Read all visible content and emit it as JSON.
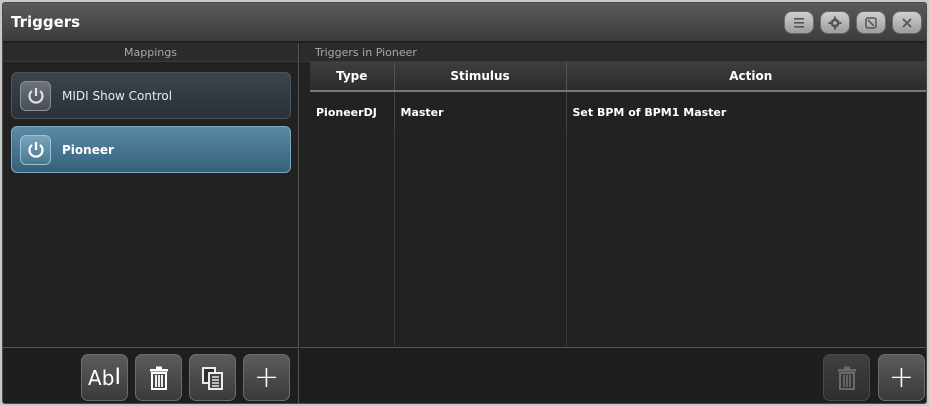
{
  "window": {
    "title": "Triggers"
  },
  "mappings": {
    "header": "Mappings",
    "items": [
      {
        "label": "MIDI Show Control",
        "selected": false,
        "icon": "power-icon"
      },
      {
        "label": "Pioneer",
        "selected": true,
        "icon": "power-icon"
      }
    ],
    "toolbar": {
      "rename_label": "Ab",
      "delete_icon": "trash-icon",
      "copy_icon": "copy-icon",
      "add_label": "+"
    }
  },
  "triggers": {
    "header": "Triggers in Pioneer",
    "columns": [
      "Type",
      "Stimulus",
      "Action"
    ],
    "rows": [
      [
        "PioneerDJ",
        "Master",
        "Set BPM of BPM1 Master"
      ]
    ],
    "toolbar": {
      "delete_icon": "trash-icon",
      "add_label": "+"
    }
  },
  "colors": {
    "selected_item": "#4a7a96",
    "background": "#1f1f1f"
  }
}
